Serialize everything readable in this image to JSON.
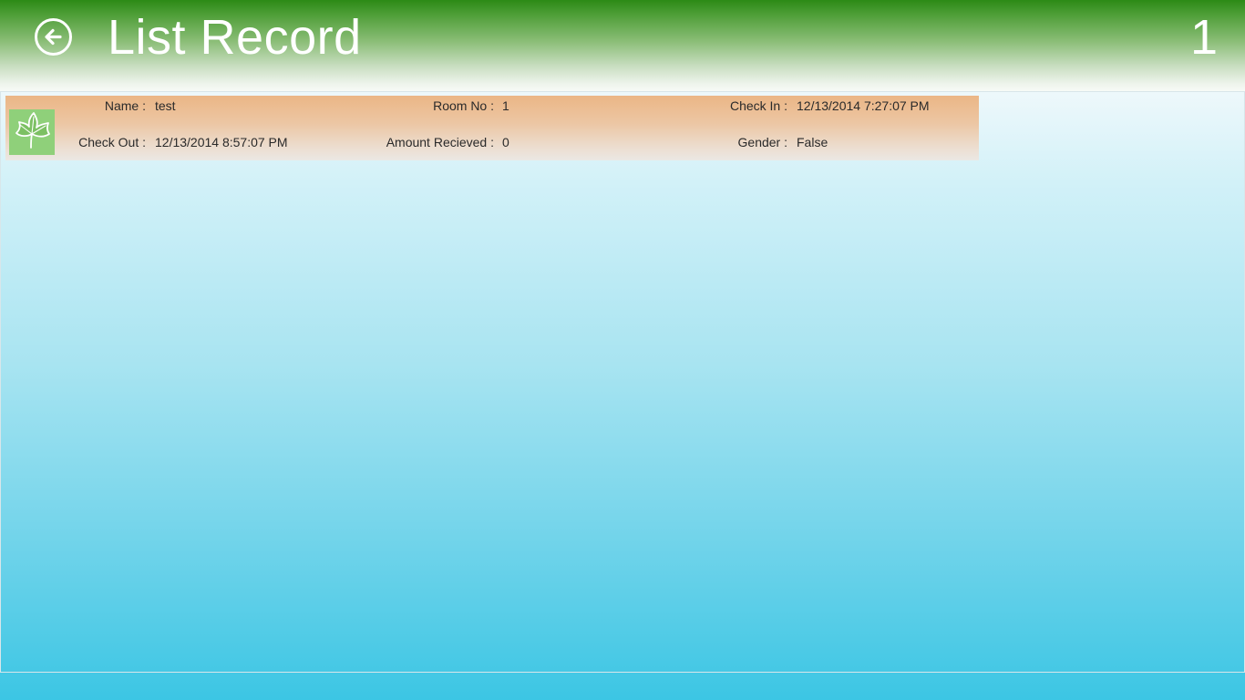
{
  "header": {
    "title": "List Record",
    "counter": "1"
  },
  "records": [
    {
      "name_label": "Name :",
      "name": "test",
      "room_label": "Room No :",
      "room": "1",
      "checkin_label": "Check In :",
      "checkin": "12/13/2014 7:27:07 PM",
      "checkout_label": "Check Out :",
      "checkout": "12/13/2014 8:57:07 PM",
      "amount_label": "Amount Recieved :",
      "amount": "0",
      "gender_label": "Gender :",
      "gender": "False",
      "thumbnail_icon": "leaf-icon"
    }
  ],
  "colors": {
    "header_green": "#2c8a16",
    "card_orange": "#ebb686",
    "thumb_green": "#8fd07a",
    "bottom_blue": "#3cc6e4"
  }
}
